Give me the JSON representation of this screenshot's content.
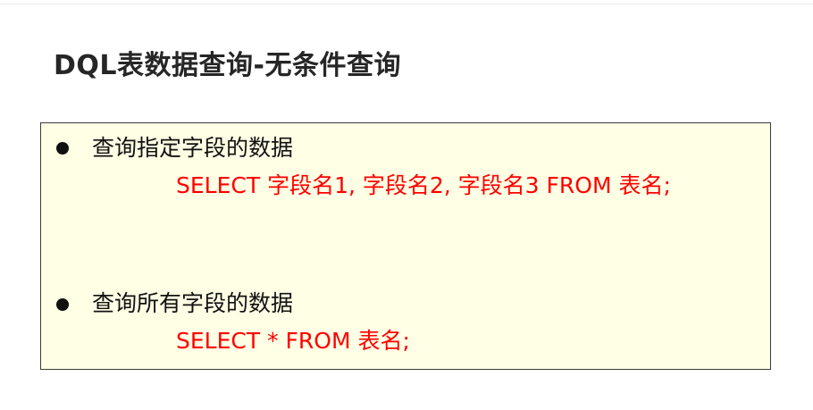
{
  "slide": {
    "title": "DQL表数据查询-无条件查询"
  },
  "items": [
    {
      "heading": "查询指定字段的数据",
      "code": "SELECT 字段名1, 字段名2, 字段名3 FROM 表名;"
    },
    {
      "heading": "查询所有字段的数据",
      "code": "SELECT * FROM 表名;"
    }
  ],
  "colors": {
    "code": "#ff0000",
    "box_background": "#ffffe5",
    "title": "#262626"
  }
}
